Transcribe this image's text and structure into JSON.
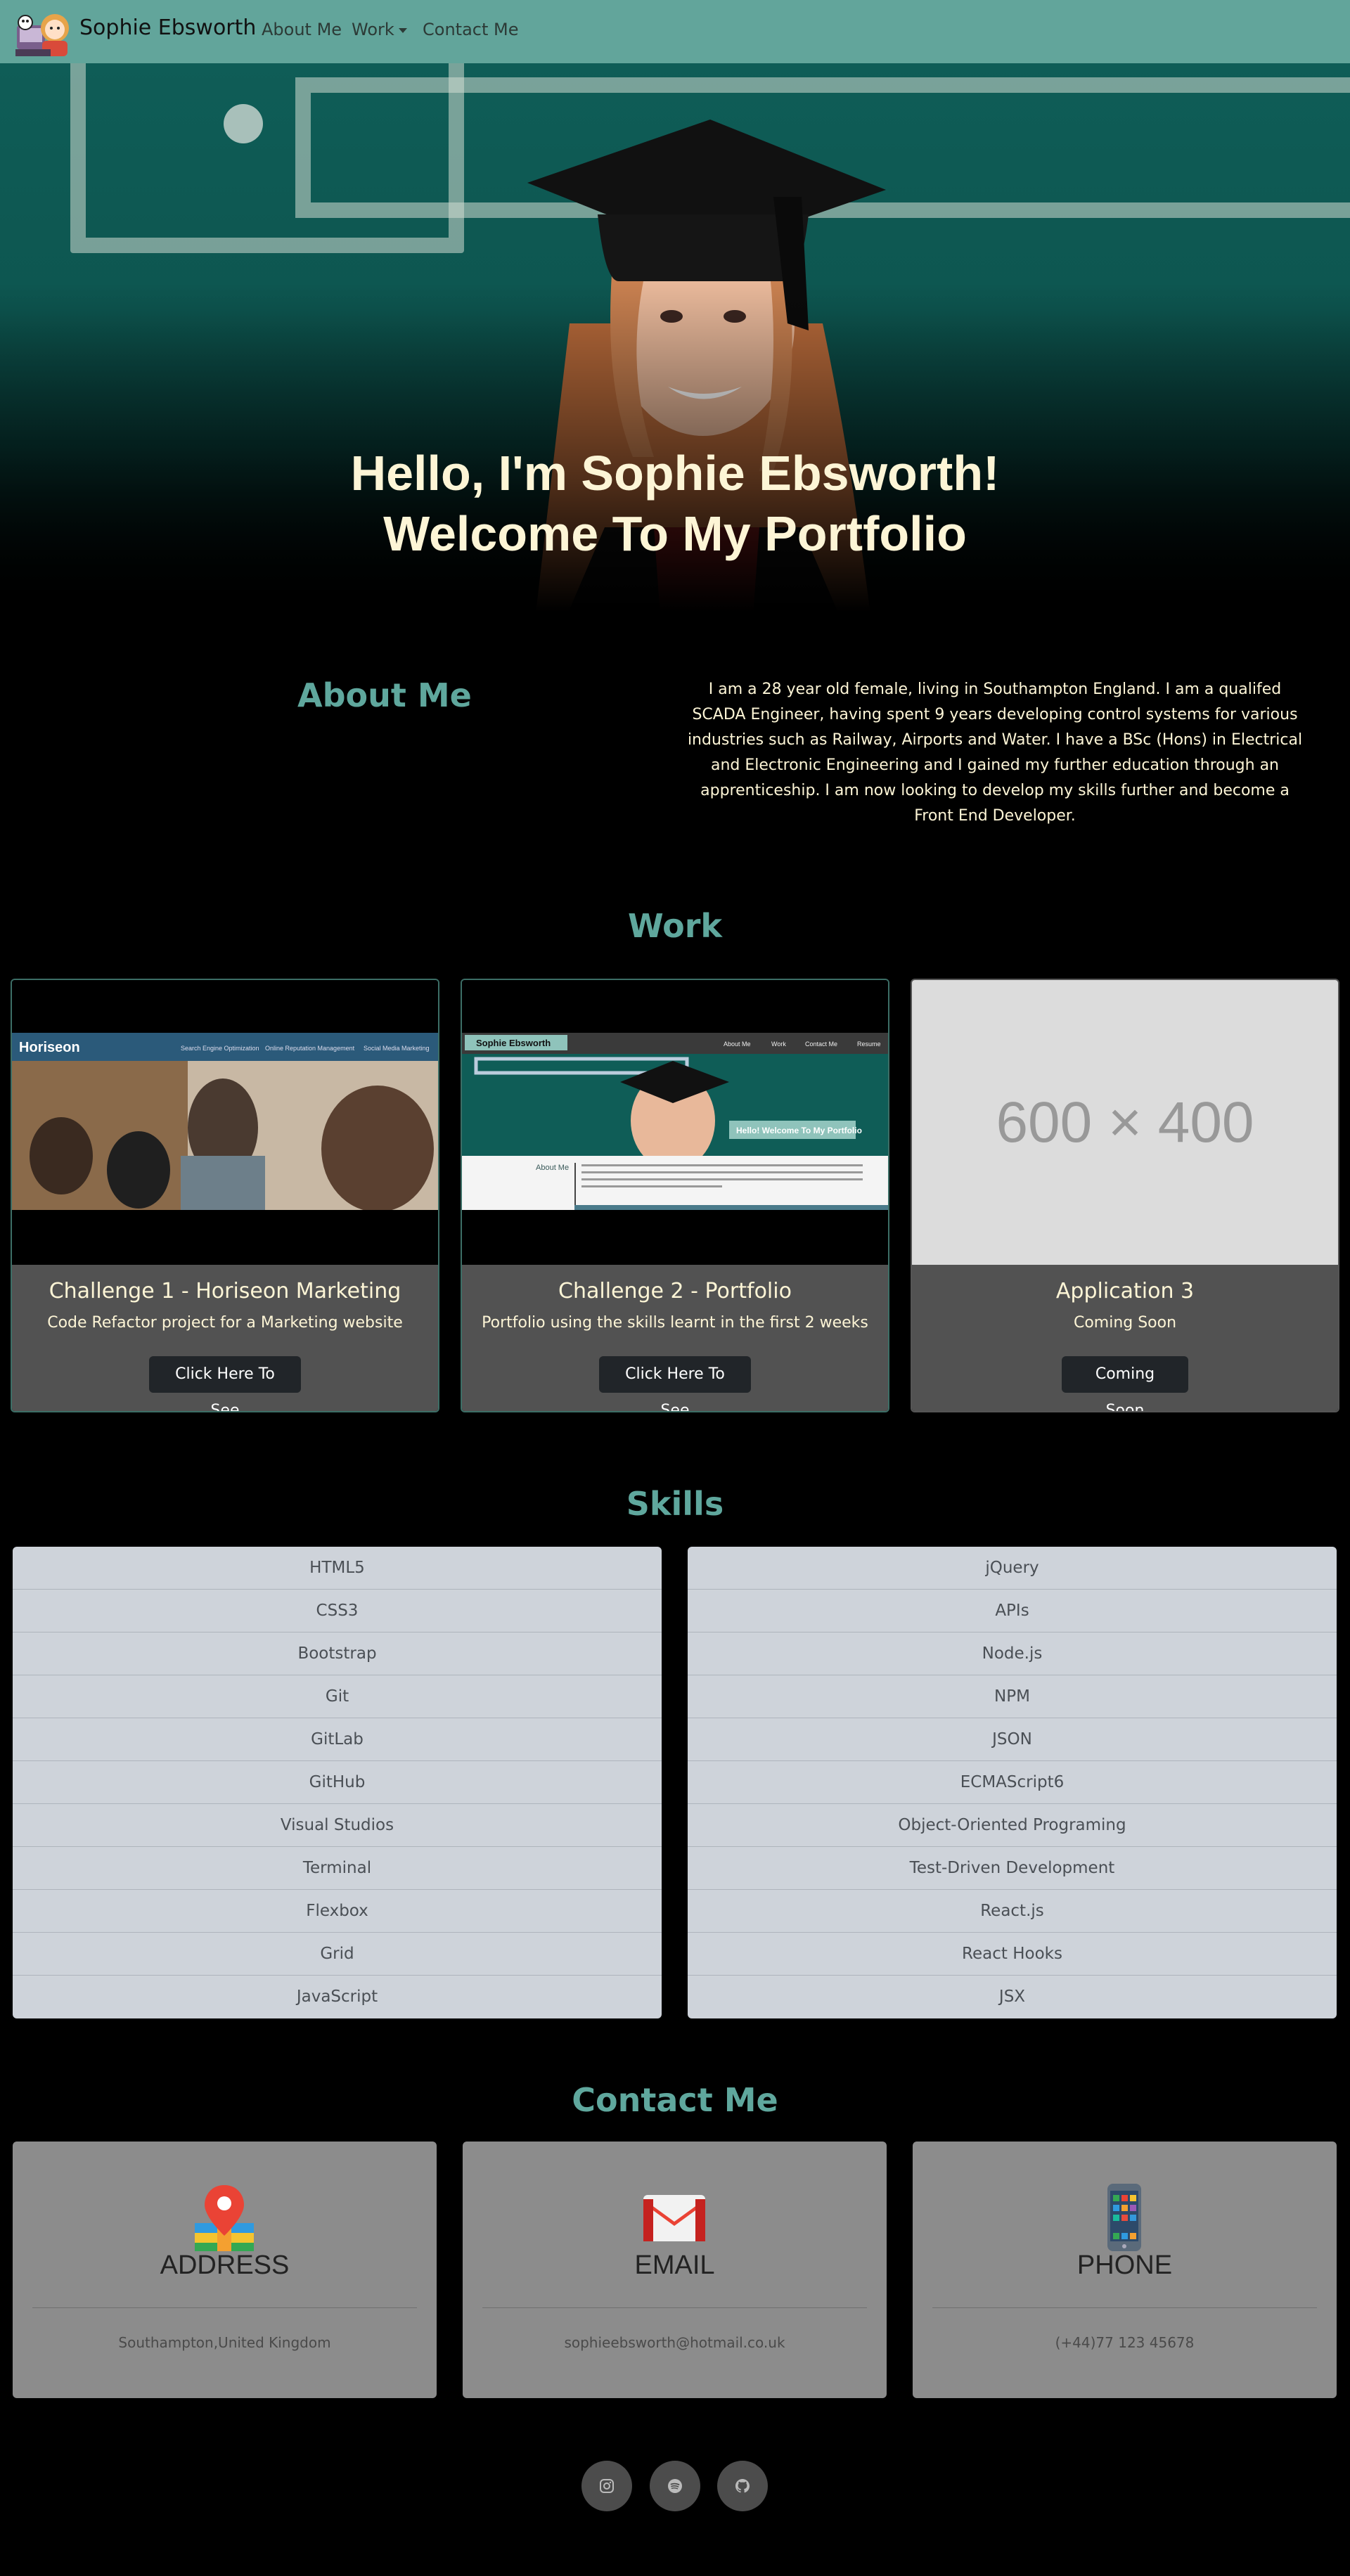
{
  "nav": {
    "brand": "Sophie Ebsworth",
    "about": "About Me",
    "work": "Work",
    "contact": "Contact Me"
  },
  "hero": {
    "line1": "Hello, I'm Sophie Ebsworth!",
    "line2": "Welcome To My Portfolio"
  },
  "about": {
    "heading": "About Me",
    "text": "I am a 28 year old female, living in Southampton England. I am a qualifed SCADA Engineer, having spent 9 years developing control systems for various industries such as Railway, Airports and Water. I have a BSc (Hons) in Electrical and Electronic Engineering and I gained my further education through an apprenticeship. I am now looking to develop my skills further and become a Front End Developer."
  },
  "work": {
    "heading": "Work",
    "cards": [
      {
        "title": "Challenge 1 - Horiseon Marketing",
        "text": "Code Refactor project for a Marketing website",
        "button": "Click Here To See",
        "thumb_brand": "Horiseon",
        "thumb_nav": [
          "Search Engine Optimization",
          "Online Reputation Management",
          "Social Media Marketing"
        ]
      },
      {
        "title": "Challenge 2 - Portfolio",
        "text": "Portfolio using the skills learnt in the first 2 weeks",
        "button": "Click Here To See",
        "thumb_brand": "Sophie Ebsworth",
        "thumb_nav": [
          "About Me",
          "Work",
          "Contact Me",
          "Resume"
        ],
        "thumb_hero": "Hello! Welcome To My Portfolio",
        "thumb_about": "About Me"
      },
      {
        "title": "Application 3",
        "text": "Coming Soon",
        "button": "Coming Soon",
        "placeholder": "600 × 400"
      }
    ]
  },
  "skills": {
    "heading": "Skills",
    "left": [
      "HTML5",
      "CSS3",
      "Bootstrap",
      "Git",
      "GitLab",
      "GitHub",
      "Visual Studios",
      "Terminal",
      "Flexbox",
      "Grid",
      "JavaScript"
    ],
    "right": [
      "jQuery",
      "APIs",
      "Node.js",
      "NPM",
      "JSON",
      "ECMAScript6",
      "Object-Oriented Programing",
      "Test-Driven Development",
      "React.js",
      "React Hooks",
      "JSX"
    ]
  },
  "contact": {
    "heading": "Contact Me",
    "cards": [
      {
        "title": "ADDRESS",
        "value": "Southampton,United Kingdom",
        "icon": "map-pin-icon"
      },
      {
        "title": "EMAIL",
        "value": "sophieebsworth@hotmail.co.uk",
        "icon": "gmail-icon"
      },
      {
        "title": "PHONE",
        "value": "(+44)77 123 45678",
        "icon": "phone-icon"
      }
    ]
  },
  "social": [
    "instagram-icon",
    "spotify-icon",
    "github-icon"
  ],
  "colors": {
    "nav": "#62a59b",
    "accent": "#5fa79d",
    "cream": "#fdf5d6",
    "card_body": "#525252"
  }
}
